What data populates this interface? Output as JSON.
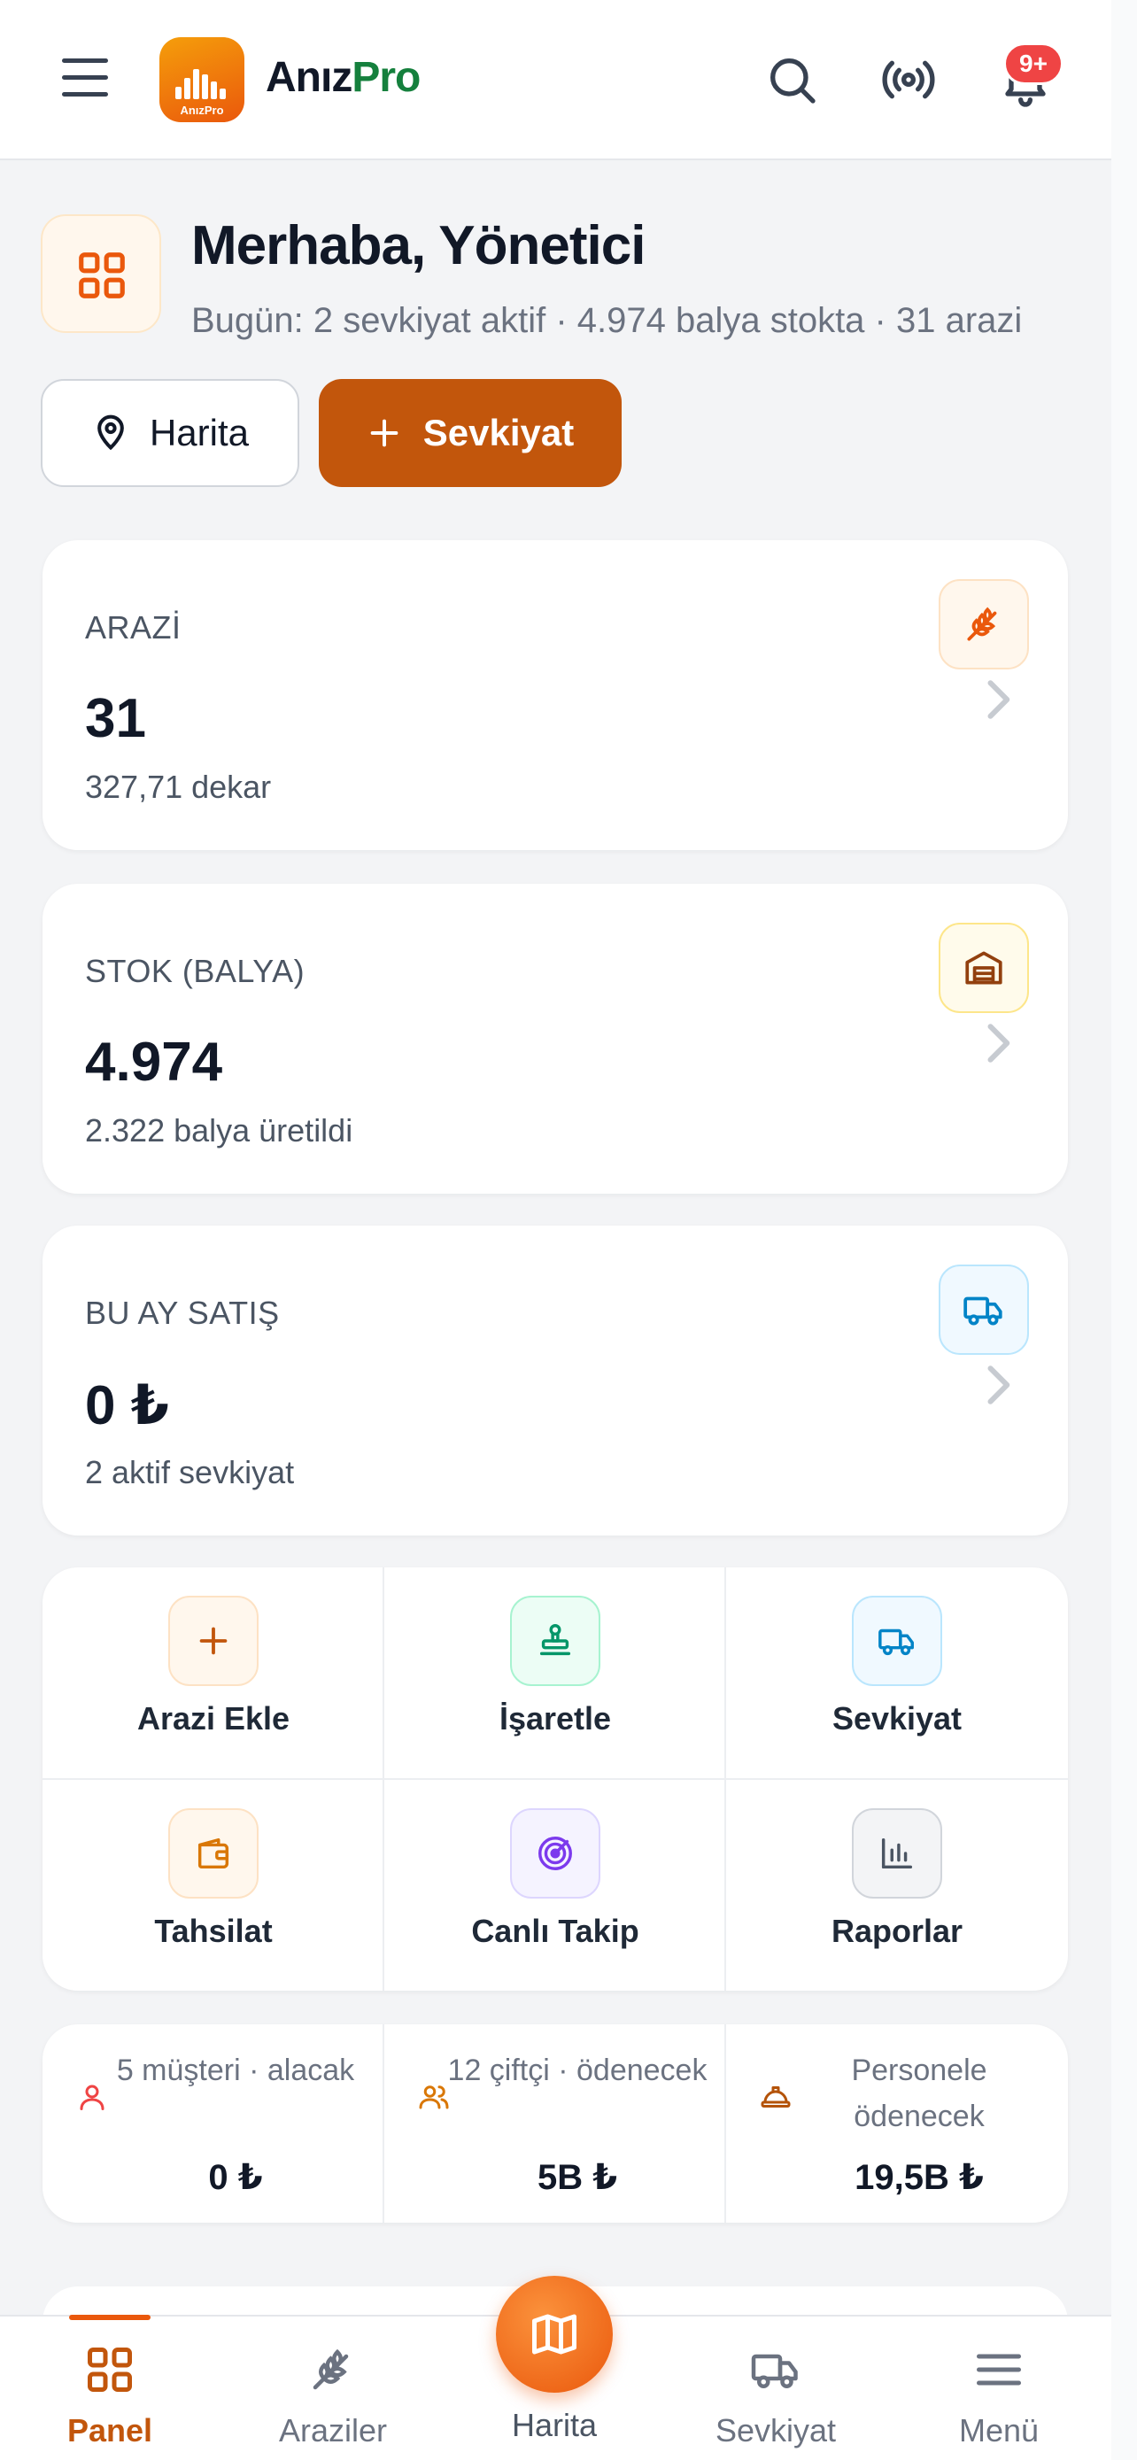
{
  "header": {
    "brand_part1": "Anız",
    "brand_part2": "Pro",
    "logo_small_text": "AnızPro",
    "notification_badge": "9+",
    "icons": [
      "menu-icon",
      "search-icon",
      "broadcast-icon",
      "bell-icon"
    ]
  },
  "greeting": {
    "title": "Merhaba, Yönetici",
    "subtitle": "Bugün: 2 sevkiyat aktif · 4.974 balya stokta · 31 arazi"
  },
  "actions": {
    "map_label": "Harita",
    "shipment_label": "Sevkiyat"
  },
  "stats": [
    {
      "label": "ARAZİ",
      "value": "31",
      "sub": "327,71 dekar",
      "icon": "wheat-icon",
      "color": "#ea580c"
    },
    {
      "label": "STOK (BALYA)",
      "value": "4.974",
      "sub": "2.322 balya üretildi",
      "icon": "warehouse-icon",
      "color": "#92400e"
    },
    {
      "label": "BU AY SATIŞ",
      "value": "0 ₺",
      "sub": "2 aktif sevkiyat",
      "icon": "truck-icon",
      "color": "#0284c7"
    }
  ],
  "quick_actions": [
    {
      "label": "Arazi Ekle",
      "icon": "plus-icon",
      "color": "#c2560c",
      "bg": "#fff7ed"
    },
    {
      "label": "İşaretle",
      "icon": "stamp-icon",
      "color": "#059669",
      "bg": "#ecfdf5"
    },
    {
      "label": "Sevkiyat",
      "icon": "truck-icon",
      "color": "#0284c7",
      "bg": "#f0f9ff"
    },
    {
      "label": "Tahsilat",
      "icon": "wallet-icon",
      "color": "#d97706",
      "bg": "#fff7ed"
    },
    {
      "label": "Canlı Takip",
      "icon": "radar-icon",
      "color": "#7c3aed",
      "bg": "#f5f3ff"
    },
    {
      "label": "Raporlar",
      "icon": "bar-chart-icon",
      "color": "#4b5563",
      "bg": "#f3f4f6"
    }
  ],
  "balances": [
    {
      "text": "5 müşteri · alacak",
      "value": "0 ₺",
      "icon": "user-icon",
      "color": "#ef4444"
    },
    {
      "text": "12 çiftçi · ödenecek",
      "value": "5B ₺",
      "icon": "users-icon",
      "color": "#d97706"
    },
    {
      "text": "Personele ödenecek",
      "value": "19,5B ₺",
      "icon": "hardhat-icon",
      "color": "#b45309"
    }
  ],
  "bottom_nav": [
    {
      "label": "Panel",
      "icon": "grid-icon",
      "active": true
    },
    {
      "label": "Araziler",
      "icon": "wheat-icon",
      "active": false
    },
    {
      "label": "Harita",
      "icon": "map-icon",
      "active": false
    },
    {
      "label": "Sevkiyat",
      "icon": "truck-icon",
      "active": false
    },
    {
      "label": "Menü",
      "icon": "menu-icon",
      "active": false
    }
  ]
}
